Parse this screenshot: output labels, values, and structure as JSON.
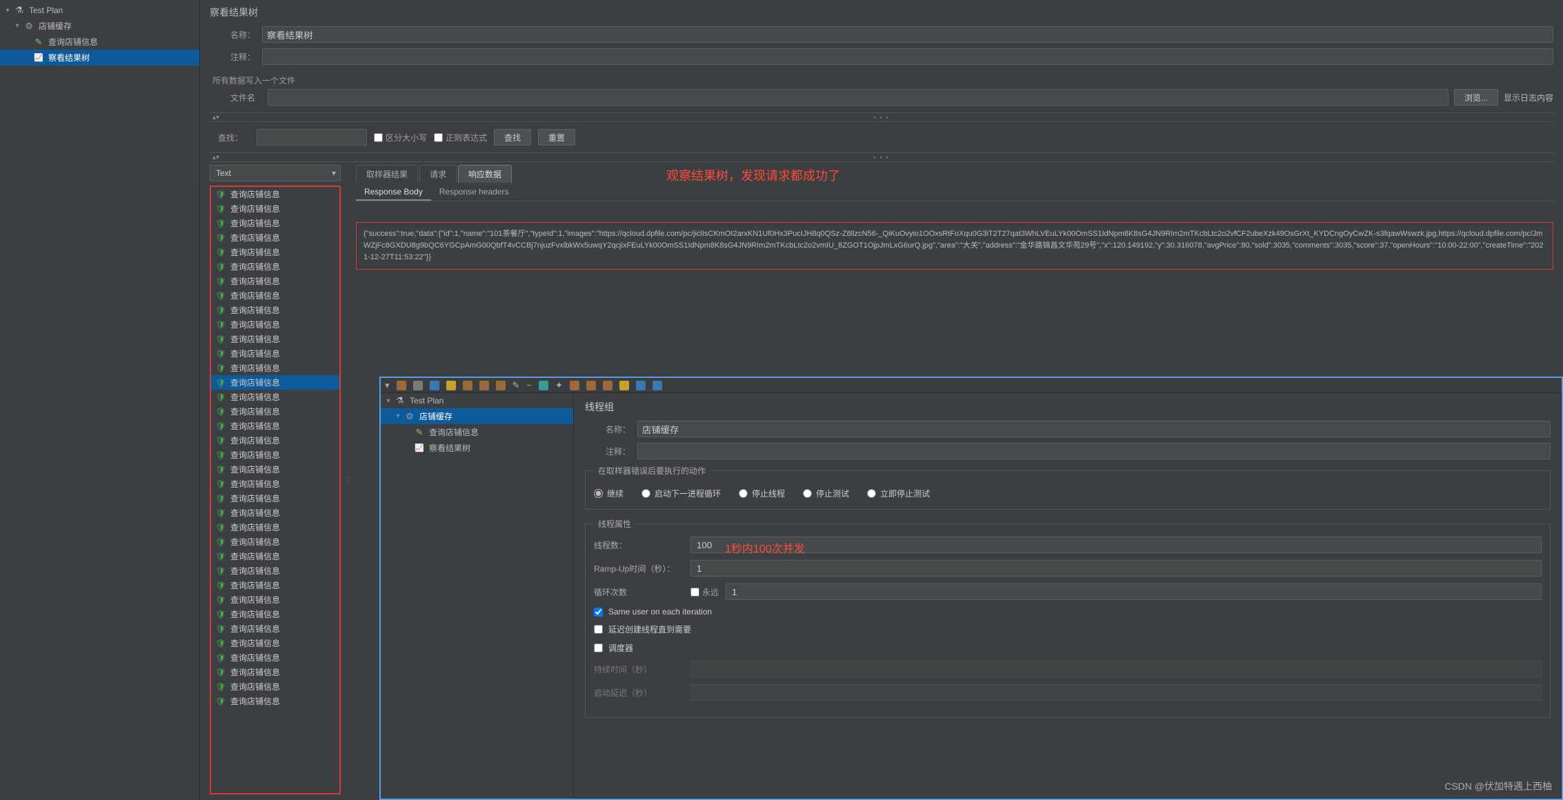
{
  "outer": {
    "tree": {
      "testPlan": "Test Plan",
      "shopCache": "店铺缓存",
      "queryShop": "查询店铺信息",
      "viewResultTree": "察看结果树"
    },
    "panel": {
      "title": "察看结果树",
      "nameLabel": "名称：",
      "nameValue": "察看结果树",
      "commentLabel": "注释：",
      "writeAllNote": "所有数据写入一个文件",
      "fileLabel": "文件名",
      "browseBtn": "浏览...",
      "logConfig": "显示日志内容",
      "searchLabel": "查找：",
      "caseCb": "区分大小写",
      "regexCb": "正则表达式",
      "searchBtn": "查找",
      "resetBtn": "重置",
      "rendererLabel": "Text"
    },
    "tabs": {
      "samplerResult": "取样器结果",
      "request": "请求",
      "responseData": "响应数据"
    },
    "subTabs": {
      "responseBody": "Response Body",
      "responseHeaders": "Response headers"
    },
    "annotation": "观察结果树，发现请求都成功了",
    "resultItemLabel": "查询店铺信息",
    "resultCount": 36,
    "responseBody": "{\"success\":true,\"data\":{\"id\":1,\"name\":\"101茶餐厅\",\"typeId\":1,\"images\":\"https://qcloud.dpfile.com/pc/jiclIsCKmOI2arxKN1Uf0Hx3PucIJH8q0QSz-Z8llzcN56-_QiKuOvyio1OOxsRtFoXqu0G3iT2T27qat3WhLVEuLYk00OmSS1IdNpm8K8sG4JN9RIm2mTKcbLtc2o2vfCF2ubeXzk49OsGrXt_KYDCngOyCwZK-s3fqawWswzk.jpg,https://qcloud.dpfile.com/pc/JmWZjFc8GXDU8g9bQC6YGCpAmG00QbfT4vCCBj7njuzFvxlbkWx5uwqY2qcjixFEuLYk00OmSS1IdNpm8K8sG4JN9RIm2mTKcbLtc2o2vmIU_8ZGOT1OjpJmLxG6urQ.jpg\",\"area\":\"大关\",\"address\":\"金华路锦昌文华苑29号\",\"x\":120.149192,\"y\":30.316078,\"avgPrice\":80,\"sold\":3035,\"comments\":3035,\"score\":37,\"openHours\":\"10:00-22:00\",\"createTime\":\"2021-12-27T11:53:22\"}}"
  },
  "inner": {
    "tree": {
      "testPlan": "Test Plan",
      "shopCache": "店铺缓存",
      "queryShop": "查询店铺信息",
      "viewResultTree": "察看结果树"
    },
    "panel": {
      "title": "线程组",
      "nameLabel": "名称：",
      "nameValue": "店铺缓存",
      "commentLabel": "注释：",
      "errorActionLegend": "在取样器错误后要执行的动作",
      "radios": {
        "continue": "继续",
        "nextLoop": "启动下一进程循环",
        "stopThread": "停止线程",
        "stopTest": "停止测试",
        "stopNow": "立即停止测试"
      },
      "threadPropsLegend": "线程属性",
      "threadCountLabel": "线程数：",
      "threadCountValue": "100",
      "rampLabel": "Ramp-Up时间（秒）：",
      "rampValue": "1",
      "loopLabel": "循环次数",
      "foreverLabel": "永远",
      "loopValue": "1",
      "sameUserLabel": "Same user on each iteration",
      "delayCreateLabel": "延迟创建线程直到需要",
      "schedulerLabel": "调度器",
      "durationLabel": "持续时间（秒）",
      "startupDelayLabel": "启动延迟（秒）",
      "annotation": "1秒内100次并发"
    }
  },
  "watermark": "CSDN @伏加特遇上西柚"
}
